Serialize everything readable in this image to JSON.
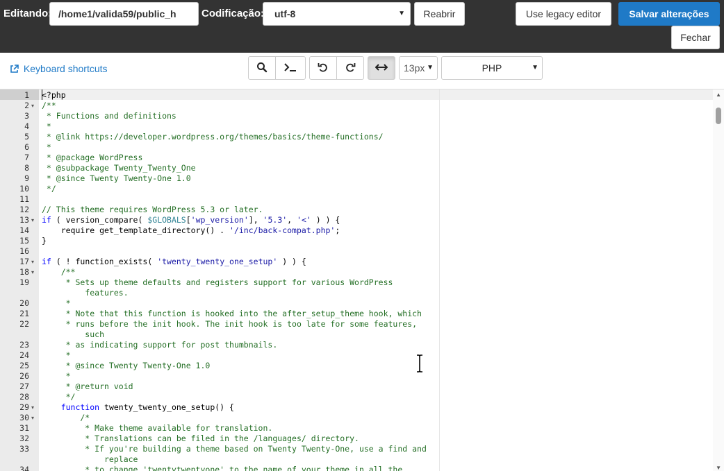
{
  "header": {
    "editing_label": "Editando:",
    "path_value": "/home1/valida59/public_h",
    "encoding_label": "Codificação:",
    "encoding_value": "utf-8",
    "reopen_label": "Reabrir",
    "legacy_label": "Use legacy editor",
    "save_label": "Salvar alterações",
    "close_label": "Fechar"
  },
  "toolbar": {
    "shortcuts_label": "Keyboard shortcuts",
    "font_size": "13px",
    "mode": "PHP",
    "icons": [
      "search-icon",
      "terminal-icon",
      "undo-icon",
      "redo-icon",
      "wrap-icon"
    ]
  },
  "colors": {
    "topbar": "#333333",
    "primary": "#1f7ac7",
    "comment": "#236e24",
    "string": "#1a1aa6",
    "variable": "#318495"
  },
  "editor": {
    "lines": [
      {
        "n": "1",
        "fold": "",
        "segments": [
          {
            "t": "<?php",
            "c": ""
          }
        ]
      },
      {
        "n": "2",
        "fold": "▾",
        "segments": [
          {
            "t": "/**",
            "c": "c-comment"
          }
        ]
      },
      {
        "n": "3",
        "fold": "",
        "segments": [
          {
            "t": " * Functions and definitions",
            "c": "c-comment"
          }
        ]
      },
      {
        "n": "4",
        "fold": "",
        "segments": [
          {
            "t": " *",
            "c": "c-comment"
          }
        ]
      },
      {
        "n": "5",
        "fold": "",
        "segments": [
          {
            "t": " * @link https://developer.wordpress.org/themes/basics/theme-functions/",
            "c": "c-comment"
          }
        ]
      },
      {
        "n": "6",
        "fold": "",
        "segments": [
          {
            "t": " *",
            "c": "c-comment"
          }
        ]
      },
      {
        "n": "7",
        "fold": "",
        "segments": [
          {
            "t": " * @package WordPress",
            "c": "c-comment"
          }
        ]
      },
      {
        "n": "8",
        "fold": "",
        "segments": [
          {
            "t": " * @subpackage Twenty_Twenty_One",
            "c": "c-comment"
          }
        ]
      },
      {
        "n": "9",
        "fold": "",
        "segments": [
          {
            "t": " * @since Twenty Twenty-One 1.0",
            "c": "c-comment"
          }
        ]
      },
      {
        "n": "10",
        "fold": "",
        "segments": [
          {
            "t": " */",
            "c": "c-comment"
          }
        ]
      },
      {
        "n": "11",
        "fold": "",
        "segments": [
          {
            "t": "",
            "c": ""
          }
        ]
      },
      {
        "n": "12",
        "fold": "",
        "segments": [
          {
            "t": "// This theme requires WordPress 5.3 or later.",
            "c": "c-comment"
          }
        ]
      },
      {
        "n": "13",
        "fold": "▾",
        "segments": [
          {
            "t": "if",
            "c": "c-kw"
          },
          {
            "t": " ( version_compare( ",
            "c": ""
          },
          {
            "t": "$GLOBALS",
            "c": "c-var"
          },
          {
            "t": "[",
            "c": ""
          },
          {
            "t": "'wp_version'",
            "c": "c-string"
          },
          {
            "t": "], ",
            "c": ""
          },
          {
            "t": "'5.3'",
            "c": "c-string"
          },
          {
            "t": ", ",
            "c": ""
          },
          {
            "t": "'<'",
            "c": "c-string"
          },
          {
            "t": " ) ) {",
            "c": ""
          }
        ]
      },
      {
        "n": "14",
        "fold": "",
        "segments": [
          {
            "t": "    require get_template_directory() . ",
            "c": ""
          },
          {
            "t": "'/inc/back-compat.php'",
            "c": "c-string"
          },
          {
            "t": ";",
            "c": ""
          }
        ]
      },
      {
        "n": "15",
        "fold": "",
        "segments": [
          {
            "t": "}",
            "c": ""
          }
        ]
      },
      {
        "n": "16",
        "fold": "",
        "segments": [
          {
            "t": "",
            "c": ""
          }
        ]
      },
      {
        "n": "17",
        "fold": "▾",
        "segments": [
          {
            "t": "if",
            "c": "c-kw"
          },
          {
            "t": " ( ! function_exists( ",
            "c": ""
          },
          {
            "t": "'twenty_twenty_one_setup'",
            "c": "c-string"
          },
          {
            "t": " ) ) {",
            "c": ""
          }
        ]
      },
      {
        "n": "18",
        "fold": "▾",
        "segments": [
          {
            "t": "    /**",
            "c": "c-comment"
          }
        ]
      },
      {
        "n": "19",
        "fold": "",
        "segments": [
          {
            "t": "     * Sets up theme defaults and registers support for various WordPress",
            "c": "c-comment"
          }
        ]
      },
      {
        "n": "",
        "fold": "",
        "segments": [
          {
            "t": "         features.",
            "c": "c-comment"
          }
        ]
      },
      {
        "n": "20",
        "fold": "",
        "segments": [
          {
            "t": "     *",
            "c": "c-comment"
          }
        ]
      },
      {
        "n": "21",
        "fold": "",
        "segments": [
          {
            "t": "     * Note that this function is hooked into the after_setup_theme hook, which",
            "c": "c-comment"
          }
        ]
      },
      {
        "n": "22",
        "fold": "",
        "segments": [
          {
            "t": "     * runs before the init hook. The init hook is too late for some features,",
            "c": "c-comment"
          }
        ]
      },
      {
        "n": "",
        "fold": "",
        "segments": [
          {
            "t": "         such",
            "c": "c-comment"
          }
        ]
      },
      {
        "n": "23",
        "fold": "",
        "segments": [
          {
            "t": "     * as indicating support for post thumbnails.",
            "c": "c-comment"
          }
        ]
      },
      {
        "n": "24",
        "fold": "",
        "segments": [
          {
            "t": "     *",
            "c": "c-comment"
          }
        ]
      },
      {
        "n": "25",
        "fold": "",
        "segments": [
          {
            "t": "     * @since Twenty Twenty-One 1.0",
            "c": "c-comment"
          }
        ]
      },
      {
        "n": "26",
        "fold": "",
        "segments": [
          {
            "t": "     *",
            "c": "c-comment"
          }
        ]
      },
      {
        "n": "27",
        "fold": "",
        "segments": [
          {
            "t": "     * @return void",
            "c": "c-comment"
          }
        ]
      },
      {
        "n": "28",
        "fold": "",
        "segments": [
          {
            "t": "     */",
            "c": "c-comment"
          }
        ]
      },
      {
        "n": "29",
        "fold": "▾",
        "segments": [
          {
            "t": "    function",
            "c": "c-kw"
          },
          {
            "t": " twenty_twenty_one_setup() {",
            "c": ""
          }
        ]
      },
      {
        "n": "30",
        "fold": "▾",
        "segments": [
          {
            "t": "        /*",
            "c": "c-comment"
          }
        ]
      },
      {
        "n": "31",
        "fold": "",
        "segments": [
          {
            "t": "         * Make theme available for translation.",
            "c": "c-comment"
          }
        ]
      },
      {
        "n": "32",
        "fold": "",
        "segments": [
          {
            "t": "         * Translations can be filed in the /languages/ directory.",
            "c": "c-comment"
          }
        ]
      },
      {
        "n": "33",
        "fold": "",
        "segments": [
          {
            "t": "         * If you're building a theme based on Twenty Twenty-One, use a find and",
            "c": "c-comment"
          }
        ]
      },
      {
        "n": "",
        "fold": "",
        "segments": [
          {
            "t": "             replace",
            "c": "c-comment"
          }
        ]
      },
      {
        "n": "34",
        "fold": "",
        "segments": [
          {
            "t": "         * to change 'twentytwentyone' to the name of your theme in all the",
            "c": "c-comment"
          }
        ]
      }
    ]
  }
}
